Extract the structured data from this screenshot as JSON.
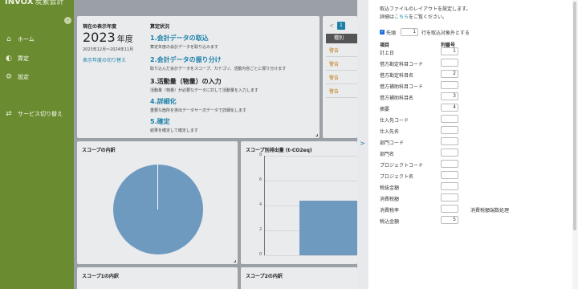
{
  "app": {
    "logo": "INVOX",
    "logo_sub": "炭素会計"
  },
  "sidebar": {
    "items": [
      {
        "label": "ホーム",
        "icon": "home-icon"
      },
      {
        "label": "算定",
        "icon": "calculation-icon"
      },
      {
        "label": "設定",
        "icon": "settings-gear-icon"
      },
      {
        "label": "サービス切り替え",
        "icon": "switch-service-icon"
      }
    ]
  },
  "dashboard": {
    "year_label": "現在の表示年度",
    "year_value": "2023",
    "year_suffix": "年度",
    "year_range": "2023年12月〜2024年11月",
    "year_switch": "表示年度の切り替え",
    "steps_label": "算定状況",
    "steps": [
      {
        "title": "1.会計データの取込",
        "desc": "算定年度の会計データを取り込みます"
      },
      {
        "title": "2.会計データの振り分け",
        "desc": "取り込んだ会計データをスコープ、カテゴリ、活動内容ごとに振り分けます"
      },
      {
        "title": "3.活動量（物量）の入力",
        "desc": "活動量（物量）が必要なデータに対して活動量を入力します"
      },
      {
        "title": "4.詳細化",
        "desc": "重要な箇所を排出データサー次データで詳細化します"
      },
      {
        "title": "5.確定",
        "desc": "結果を確定して確定します"
      }
    ],
    "pager": {
      "prev": "<",
      "page": "1"
    },
    "side_table": {
      "header": "種別",
      "rows": [
        "警告",
        "警告",
        "警告",
        "警告"
      ]
    },
    "scope_chart_title": "スコープの内訳",
    "emission_chart_title": "スコープ別排出量 (t-CO2eq)",
    "scope1_title": "スコープ1の内訳",
    "scope2_title": "スコープ2の内訳"
  },
  "chart_data": [
    {
      "type": "pie",
      "title": "スコープの内訳",
      "values": [
        99.9,
        0.1
      ],
      "colors": [
        "#6e9ac0",
        "#ffffff"
      ]
    },
    {
      "type": "bar",
      "title": "スコープ別排出量 (t-CO2eq)",
      "ylim": [
        0,
        8
      ],
      "yticks": [
        "0",
        "2",
        "4",
        "6",
        "8"
      ],
      "values": [
        4.4
      ],
      "colors": [
        "#6e9ac0"
      ]
    }
  ],
  "drawer": {
    "handle_icon": ">",
    "intro_line1": "取込ファイルのレイアウトを設定します。",
    "intro_line2_pre": "詳細は",
    "intro_line2_link": "こちら",
    "intro_line2_post": "をご覧ください。",
    "skip_checkbox_label": "先頭",
    "skip_value": "1",
    "skip_suffix": "行を取込対象外とする",
    "col_header_item": "項目",
    "col_header_num": "列番号",
    "fields": [
      {
        "label": "計上日",
        "value": "1"
      },
      {
        "label": "借方勘定科目コード",
        "value": ""
      },
      {
        "label": "借方勘定科目名",
        "value": "2"
      },
      {
        "label": "借方補助科目コード",
        "value": ""
      },
      {
        "label": "借方補助科目名",
        "value": "3"
      },
      {
        "label": "摘要",
        "value": "4"
      },
      {
        "label": "仕入先コード",
        "value": ""
      },
      {
        "label": "仕入先名",
        "value": ""
      },
      {
        "label": "部門コード",
        "value": ""
      },
      {
        "label": "部門名",
        "value": ""
      },
      {
        "label": "プロジェクトコード",
        "value": ""
      },
      {
        "label": "プロジェクト名",
        "value": ""
      },
      {
        "label": "税抜金額",
        "value": ""
      },
      {
        "label": "消費税額",
        "value": ""
      },
      {
        "label": "消費税率",
        "value": "",
        "extra": "消費税額端数処理"
      },
      {
        "label": "税込金額",
        "value": "5"
      }
    ]
  },
  "colors": {
    "sidebar": "#6a8b2f",
    "accent": "#1c7fa8",
    "chart": "#6e9ac0",
    "warning": "#c27c14"
  }
}
